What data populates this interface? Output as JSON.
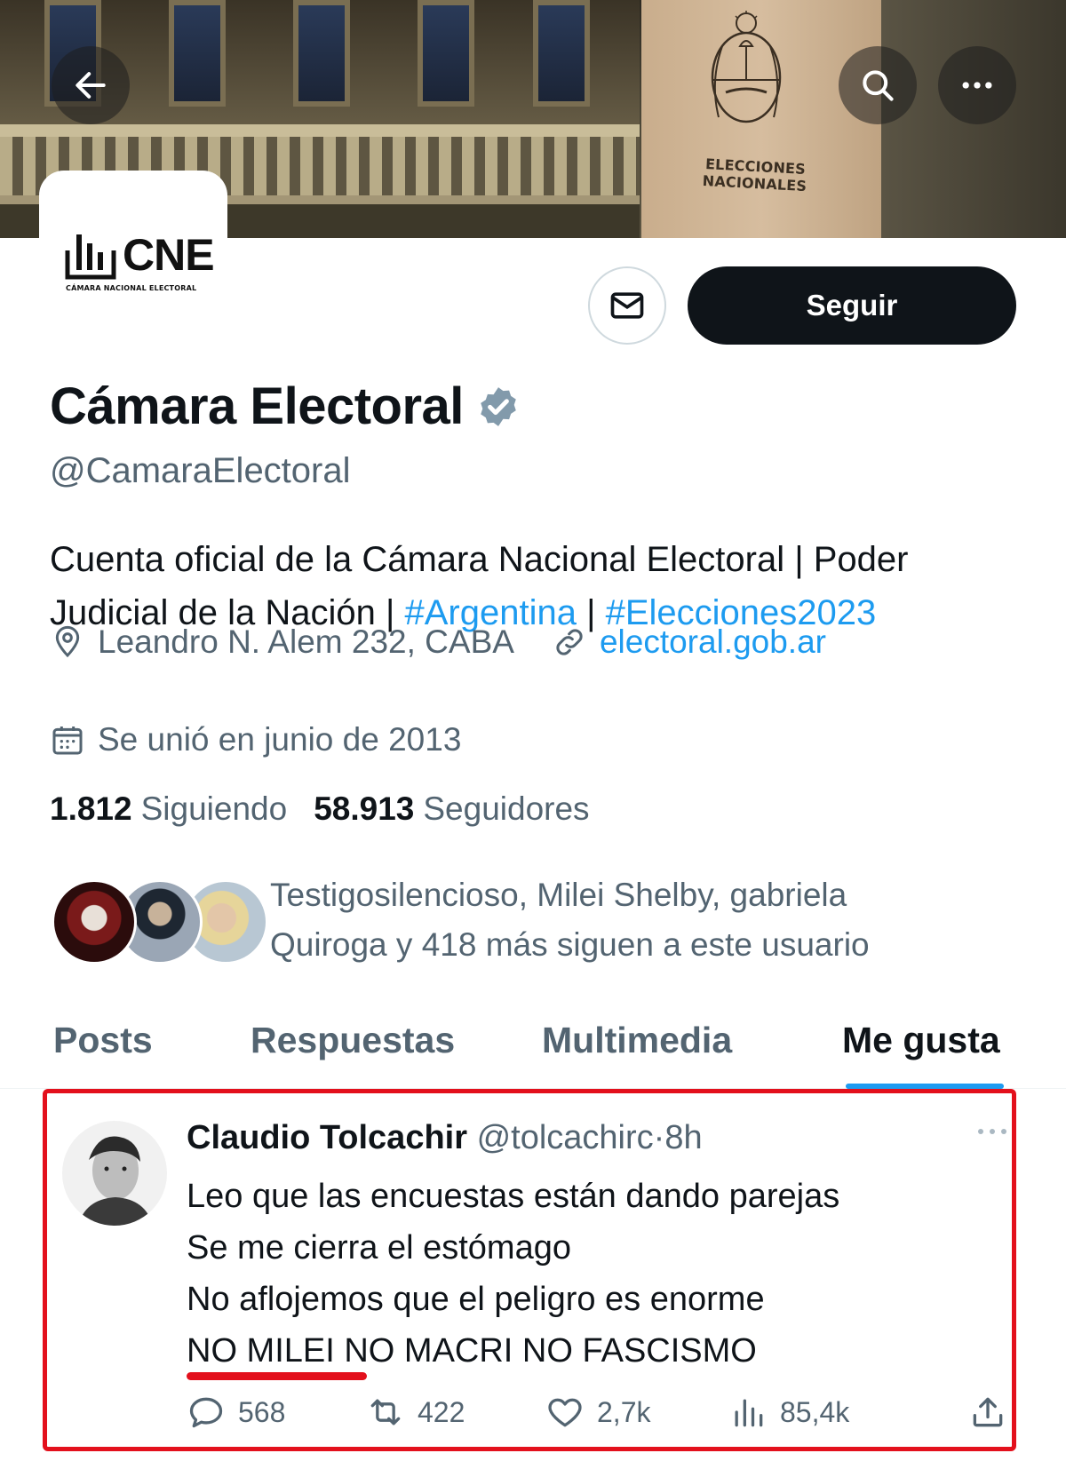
{
  "banner": {
    "box_label": "ELECCIONES NACIONALES",
    "back_icon": "arrow-left-icon",
    "search_icon": "search-icon",
    "more_icon": "more-horizontal-icon"
  },
  "avatar": {
    "logo_text": "CNE",
    "logo_subtitle": "CÁMARA NACIONAL ELECTORAL"
  },
  "actions": {
    "message_icon": "envelope-icon",
    "follow_label": "Seguir"
  },
  "profile": {
    "name": "Cámara Electoral",
    "verified_icon": "verified-badge-icon",
    "handle": "@CamaraElectoral",
    "bio": {
      "text_1": "Cuenta oficial de la Cámara Nacional Electoral | Poder Judicial de la Nación | ",
      "hashtag_1": "#Argentina",
      "separator": " | ",
      "hashtag_2": "#Elecciones2023"
    },
    "location": "Leandro N. Alem 232, CABA",
    "website": "electoral.gob.ar",
    "joined": "Se unió en junio de 2013",
    "following_count": "1.812",
    "following_label": "Siguiendo",
    "followers_count": "58.913",
    "followers_label": "Seguidores",
    "known_followers_line_1": "Testigosilencioso, Milei Shelby, gabriela",
    "known_followers_line_2": "Quiroga y 418 más siguen a este usuario"
  },
  "tabs": [
    {
      "label": "Posts",
      "active": false
    },
    {
      "label": "Respuestas",
      "active": false
    },
    {
      "label": "Multimedia",
      "active": false
    },
    {
      "label": "Me gusta",
      "active": true
    }
  ],
  "tweet": {
    "author": "Claudio Tolcachir",
    "handle": "@tolcachirc",
    "separator": "·",
    "time": "8h",
    "lines": [
      "Leo que las encuestas están dando parejas",
      "Se me cierra el estómago",
      "No aflojemos que el peligro es enorme",
      "NO MILEI NO MACRI NO FASCISMO"
    ],
    "replies": "568",
    "reposts": "422",
    "likes": "2,7k",
    "views": "85,4k"
  },
  "colors": {
    "accent": "#1d9bf0",
    "text_primary": "#0f1419",
    "text_secondary": "#536471",
    "highlight_red": "#e3101c"
  }
}
